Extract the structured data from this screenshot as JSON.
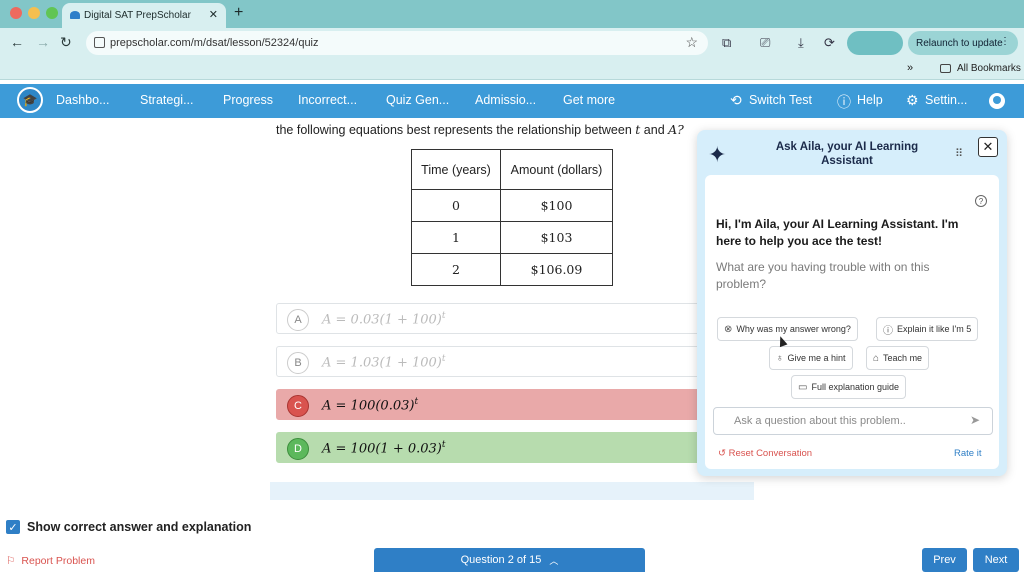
{
  "browser": {
    "tab_title": "Digital SAT PrepScholar",
    "url": "prepscholar.com/m/dsat/lesson/52324/quiz",
    "relaunch_label": "Relaunch to update",
    "bookmarks_label": "All Bookmarks"
  },
  "nav": {
    "items": [
      "Dashbo...",
      "Strategi...",
      "Progress",
      "Incorrect...",
      "Quiz Gen...",
      "Admissio...",
      "Get more"
    ],
    "switch_test": "Switch Test",
    "help": "Help",
    "settings": "Settin..."
  },
  "question": {
    "text": "the following equations best represents the relationship between",
    "var_t": "t",
    "and": "and",
    "var_A": "A?",
    "table": {
      "headers": [
        "Time (years)",
        "Amount (dollars)"
      ],
      "rows": [
        [
          "0",
          "$100"
        ],
        [
          "1",
          "$103"
        ],
        [
          "2",
          "$106.09"
        ]
      ]
    },
    "choices": [
      {
        "letter": "A",
        "equation": "A = 0.03(1 + 100)",
        "exp": "t"
      },
      {
        "letter": "B",
        "equation": "A = 1.03(1 + 100)",
        "exp": "t"
      },
      {
        "letter": "C",
        "equation": "A = 100(0.03)",
        "exp": "t"
      },
      {
        "letter": "D",
        "equation": "A = 100(1 + 0.03)",
        "exp": "t"
      }
    ]
  },
  "footer": {
    "show_answer_label": "Show correct answer and explanation",
    "report": "Report Problem",
    "question_counter": "Question 2 of 15",
    "prev": "Prev",
    "next": "Next"
  },
  "aila": {
    "title": "Ask Aila, your AI Learning Assistant",
    "greeting": "Hi, I'm Aila, your AI Learning Assistant. I'm here to help you ace the test!",
    "prompt": "What are you having trouble with on this problem?",
    "suggestions": [
      "Why was my answer wrong?",
      "Explain it like I'm 5",
      "Give me a hint",
      "Teach me",
      "Full explanation guide"
    ],
    "input_placeholder": "Ask a question about this problem..",
    "reset": "Reset Conversation",
    "rate": "Rate it"
  },
  "colors": {
    "nav_blue": "#3d9bd8",
    "wrong_red": "#e9a9a9",
    "correct_green": "#b7dcae",
    "button_blue": "#2f7fc6"
  }
}
